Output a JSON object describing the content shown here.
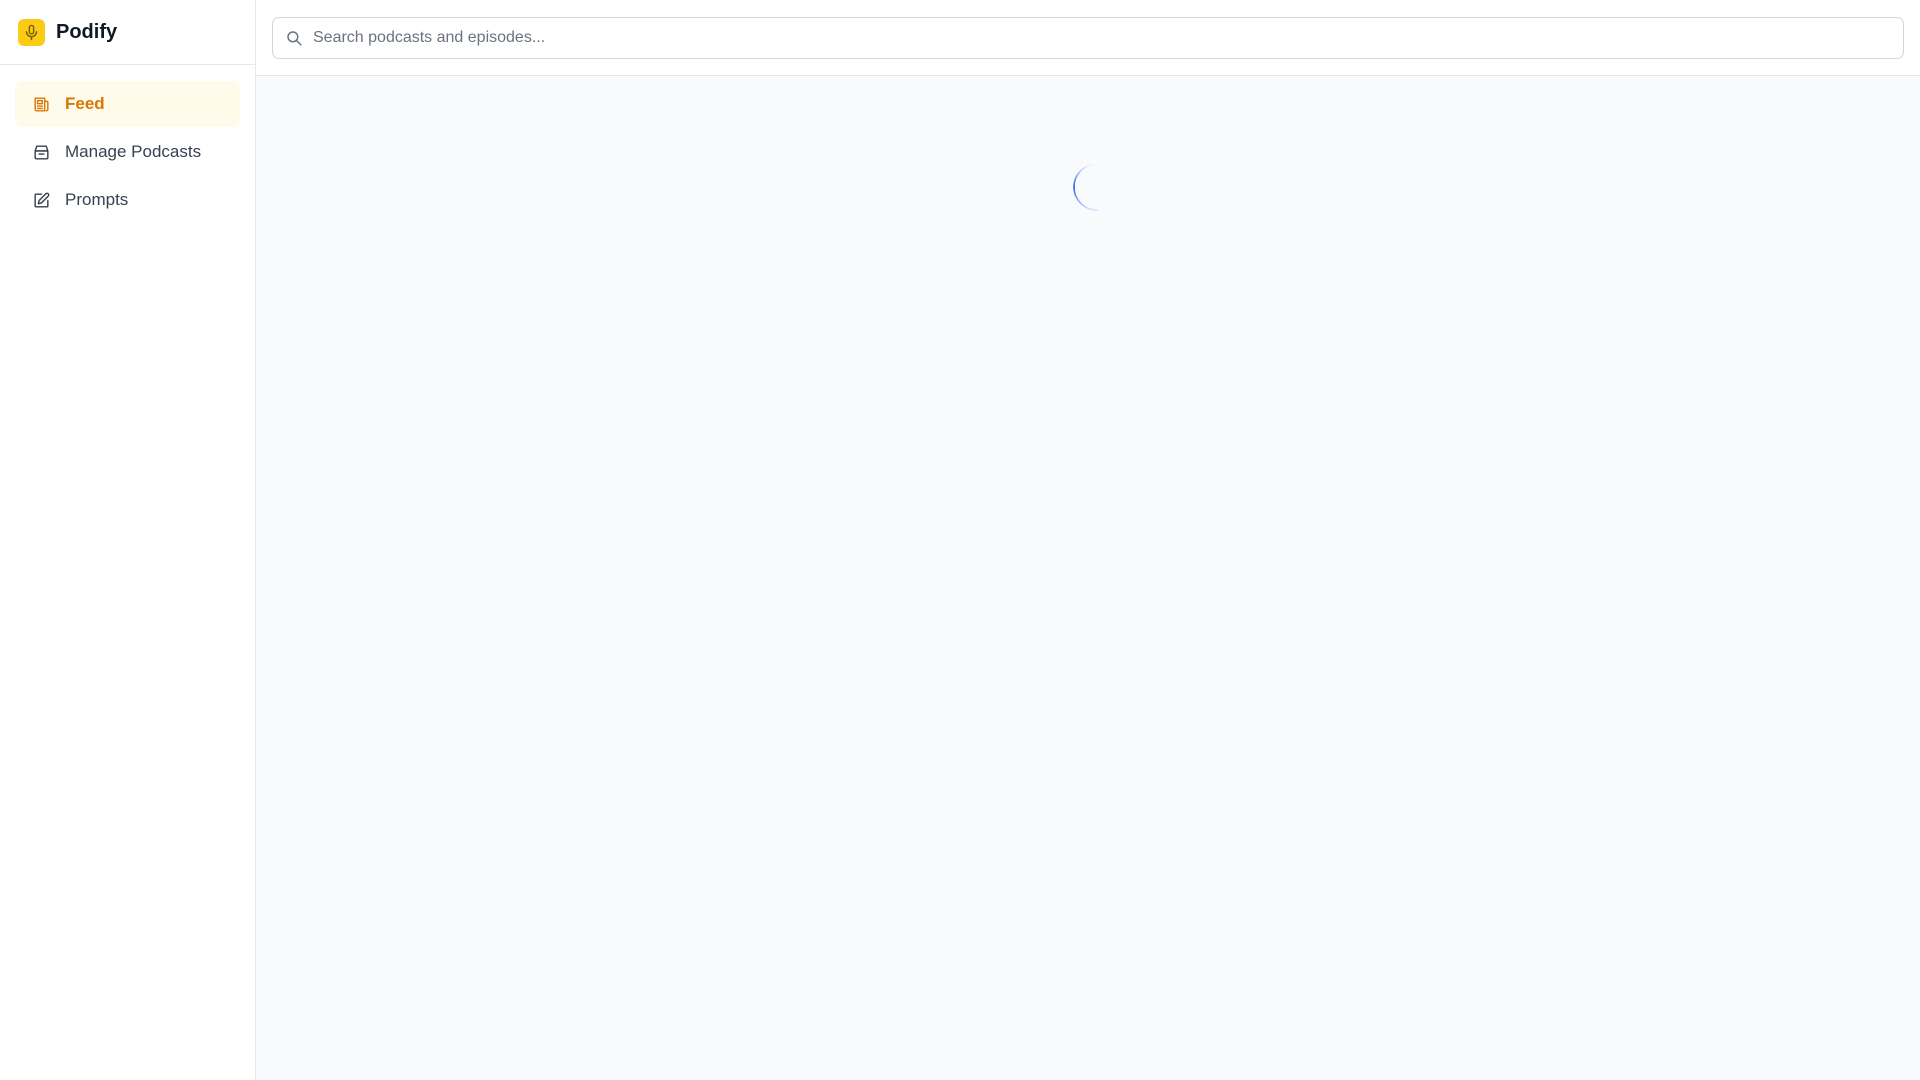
{
  "app": {
    "name": "Podify",
    "logo_icon": "microphone-icon",
    "logo_bg": "#facc15",
    "logo_fg": "#7c5a00"
  },
  "sidebar": {
    "accent": "#d97706",
    "active_bg": "#fffbeb",
    "items": [
      {
        "label": "Feed",
        "icon": "newspaper-icon",
        "active": true
      },
      {
        "label": "Manage Podcasts",
        "icon": "archive-box-icon",
        "active": false
      },
      {
        "label": "Prompts",
        "icon": "edit-square-icon",
        "active": false
      }
    ]
  },
  "search": {
    "placeholder": "Search podcasts and episodes...",
    "value": "",
    "icon": "search-icon"
  },
  "content": {
    "state": "loading",
    "spinner_color": "#2563eb"
  }
}
